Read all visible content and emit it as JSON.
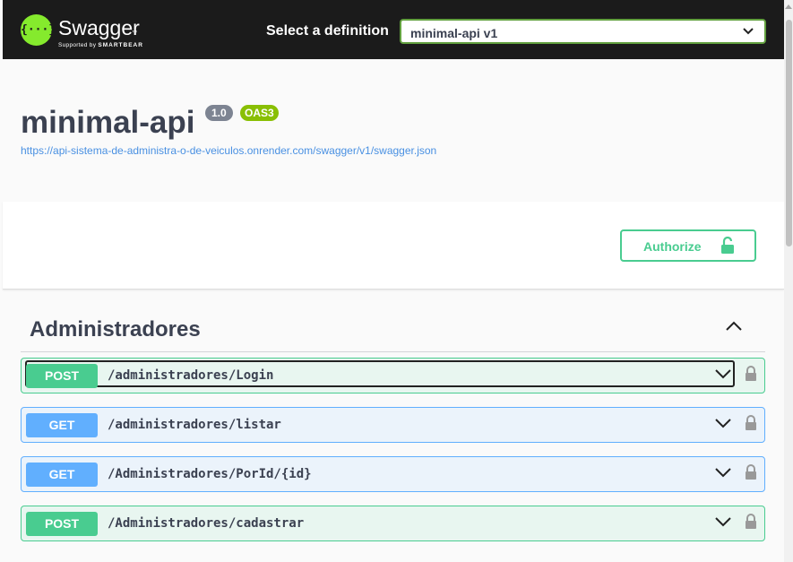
{
  "topbar": {
    "logo_mark": "{···}",
    "logo_name": "Swagger",
    "logo_tm": "™",
    "logo_sub_prefix": "Supported by",
    "logo_sub_brand": "SMARTBEAR",
    "definition_label": "Select a definition",
    "definition_value": "minimal-api v1"
  },
  "info": {
    "title": "minimal-api",
    "version": "1.0",
    "oas": "OAS3",
    "spec_url": "https://api-sistema-de-administra-o-de-veiculos.onrender.com/swagger/v1/swagger.json"
  },
  "authorize": {
    "label": "Authorize"
  },
  "tag": {
    "name": "Administradores"
  },
  "operations": [
    {
      "method": "POST",
      "path": "/administradores/Login"
    },
    {
      "method": "GET",
      "path": "/administradores/listar"
    },
    {
      "method": "GET",
      "path": "/Administradores/PorId/{id}"
    },
    {
      "method": "POST",
      "path": "/Administradores/cadastrar"
    }
  ],
  "colors": {
    "topbar": "#1b1b1b",
    "brand_green": "#85ea2d",
    "post": "#49cc90",
    "get": "#61affe",
    "link": "#4990e2"
  },
  "icons": [
    "swagger-logo-icon",
    "chevron-down-icon",
    "chevron-up-icon",
    "unlocked-icon",
    "lock-icon"
  ]
}
